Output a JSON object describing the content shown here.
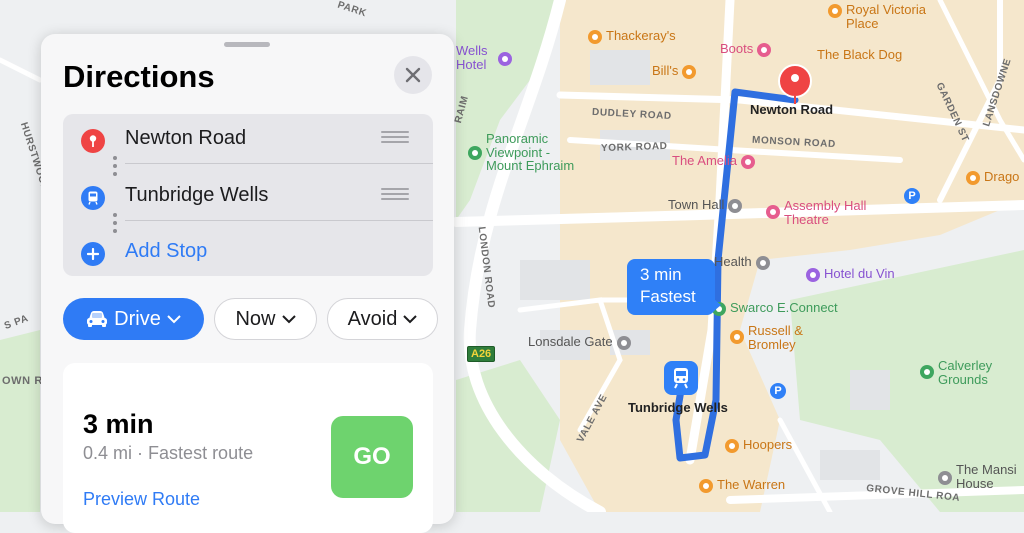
{
  "panel": {
    "title": "Directions",
    "stops": [
      {
        "label": "Newton Road",
        "icon": "pin-icon",
        "color": "#ef4444"
      },
      {
        "label": "Tunbridge Wells",
        "icon": "train-icon",
        "color": "#2f7bf5"
      }
    ],
    "add_stop": "Add Stop",
    "filters": {
      "drive": "Drive",
      "now": "Now",
      "avoid": "Avoid"
    },
    "route": {
      "time": "3 min",
      "distance": "0.4 mi",
      "summary": "Fastest route",
      "preview": "Preview Route",
      "go": "GO"
    }
  },
  "map": {
    "route_bubble": {
      "time": "3 min",
      "label": "Fastest"
    },
    "destination_label": "Newton Road",
    "origin_label": "Tunbridge Wells",
    "road_badge": "A26",
    "streets": {
      "park": "PARK",
      "hurstwood": "HURSTWOOD LA",
      "raim": "RAIM",
      "dudley": "DUDLEY ROAD",
      "york": "YORK ROAD",
      "monson": "MONSON ROAD",
      "london": "LONDON ROAD",
      "grove_hill": "GROVE HILL ROA",
      "vale": "VALE AVE",
      "down_ro": "OWN RO",
      "garden_st": "GARDEN ST",
      "lansdowne": "LANSDOWNE",
      "s_pa": "S PA"
    },
    "pois": {
      "royal_victoria": "Royal Victoria Place",
      "thackerays": "Thackeray's",
      "boots": "Boots",
      "black_dog": "The Black Dog",
      "bills": "Bill's",
      "wells_hotel": "Wells Hotel",
      "panoramic": "Panoramic Viewpoint - Mount Ephraim",
      "amelia": "The Amelia",
      "drago": "Drago",
      "town_hall": "Town Hall",
      "assembly": "Assembly Hall Theatre",
      "health": "Health",
      "hotel_du_vin": "Hotel du Vin",
      "swarco": "Swarco E.Connect",
      "russell": "Russell & Bromley",
      "lonsdale": "Lonsdale Gate",
      "calverley": "Calverley Grounds",
      "hoopers": "Hoopers",
      "warren": "The Warren",
      "mansion": "The Mansi House"
    }
  }
}
